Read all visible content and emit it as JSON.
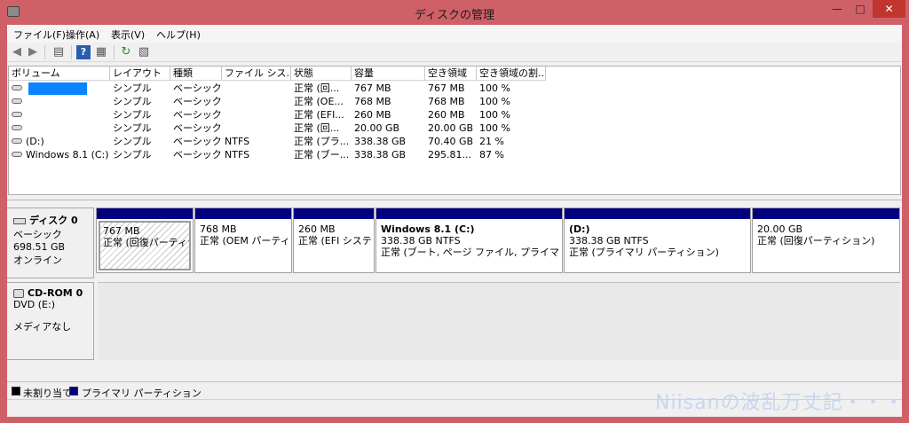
{
  "window": {
    "title": "ディスクの管理",
    "min_glyph": "—",
    "max_glyph": "□",
    "close_glyph": "✕"
  },
  "menu": [
    "ファイル(F)",
    "操作(A)",
    "表示(V)",
    "ヘルプ(H)"
  ],
  "toolbar": {
    "icons": [
      "back-arrow-icon",
      "forward-arrow-icon",
      "console-tree-icon",
      "help-icon",
      "properties-icon",
      "refresh-icon",
      "export-list-icon"
    ]
  },
  "volume_list": {
    "headers": [
      "ボリューム",
      "レイアウト",
      "種類",
      "ファイル シス...",
      "状態",
      "容量",
      "空き領域",
      "空き領域の割..."
    ],
    "rows": [
      {
        "volume": "",
        "layout": "シンプル",
        "type": "ベーシック",
        "fs": "",
        "status": "正常 (回...",
        "capacity": "767 MB",
        "free": "767 MB",
        "pct": "100 %"
      },
      {
        "volume": "",
        "layout": "シンプル",
        "type": "ベーシック",
        "fs": "",
        "status": "正常 (OE...",
        "capacity": "768 MB",
        "free": "768 MB",
        "pct": "100 %"
      },
      {
        "volume": "",
        "layout": "シンプル",
        "type": "ベーシック",
        "fs": "",
        "status": "正常 (EFI...",
        "capacity": "260 MB",
        "free": "260 MB",
        "pct": "100 %"
      },
      {
        "volume": "",
        "layout": "シンプル",
        "type": "ベーシック",
        "fs": "",
        "status": "正常 (回...",
        "capacity": "20.00 GB",
        "free": "20.00 GB",
        "pct": "100 %"
      },
      {
        "volume": "(D:)",
        "layout": "シンプル",
        "type": "ベーシック",
        "fs": "NTFS",
        "status": "正常 (プラ...",
        "capacity": "338.38 GB",
        "free": "70.40 GB",
        "pct": "21 %"
      },
      {
        "volume": "Windows 8.1 (C:)",
        "layout": "シンプル",
        "type": "ベーシック",
        "fs": "NTFS",
        "status": "正常 (ブー...",
        "capacity": "338.38 GB",
        "free": "295.81...",
        "pct": "87 %"
      }
    ]
  },
  "disk0": {
    "name": "ディスク 0",
    "type": "ベーシック",
    "size": "698.51 GB",
    "status": "オンライン",
    "partitions": [
      {
        "name": "",
        "size": "767 MB",
        "status": "正常 (回復パーティション)"
      },
      {
        "name": "",
        "size": "768 MB",
        "status": "正常 (OEM パーティション)"
      },
      {
        "name": "",
        "size": "260 MB",
        "status": "正常 (EFI システム パーティション)"
      },
      {
        "name": "Windows 8.1  (C:)",
        "size": "338.38 GB NTFS",
        "status": "正常 (ブート, ページ ファイル, プライマリ パーティション)"
      },
      {
        "name": " (D:)",
        "size": "338.38 GB NTFS",
        "status": "正常 (プライマリ パーティション)"
      },
      {
        "name": "",
        "size": "20.00 GB",
        "status": "正常 (回復パーティション)"
      }
    ]
  },
  "cdrom0": {
    "name": "CD-ROM 0",
    "drive": "DVD (E:)",
    "media": "メディアなし"
  },
  "legend": {
    "unallocated": "未割り当て",
    "primary": "プライマリ パーティション",
    "unallocated_color": "#000000",
    "primary_color": "#000080"
  },
  "watermark": "Niisanの波乱万丈記・・・"
}
